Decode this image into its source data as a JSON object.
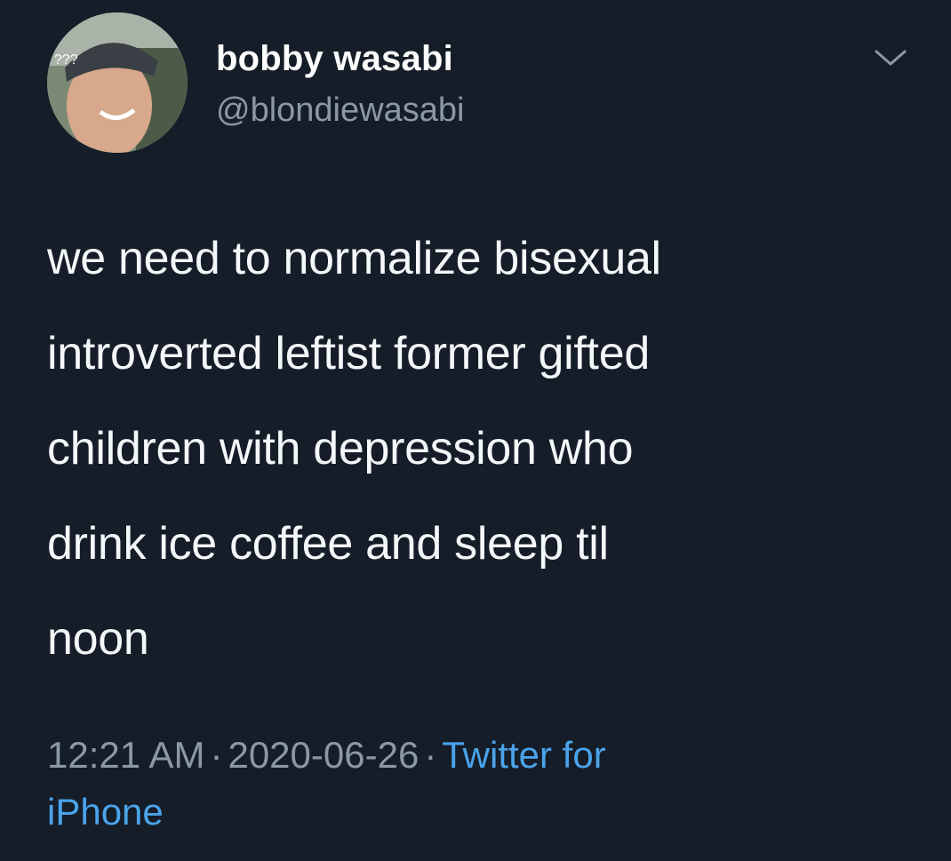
{
  "user": {
    "display_name": "bobby wasabi",
    "handle": "@blondiewasabi"
  },
  "tweet": {
    "text": "we need to normalize bisexual\nintroverted leftist former gifted\nchildren with depression who\ndrink ice coffee and sleep til\nnoon"
  },
  "meta": {
    "time": "12:21 AM",
    "separator": "·",
    "date": "2020-06-26",
    "source": "Twitter for\niPhone"
  },
  "icons": {
    "caret": "chevron-down-icon",
    "avatar": "avatar"
  },
  "colors": {
    "background": "#151d28",
    "text": "#f5f8fa",
    "secondary": "#8b98a5",
    "link": "#4aa3ea"
  }
}
